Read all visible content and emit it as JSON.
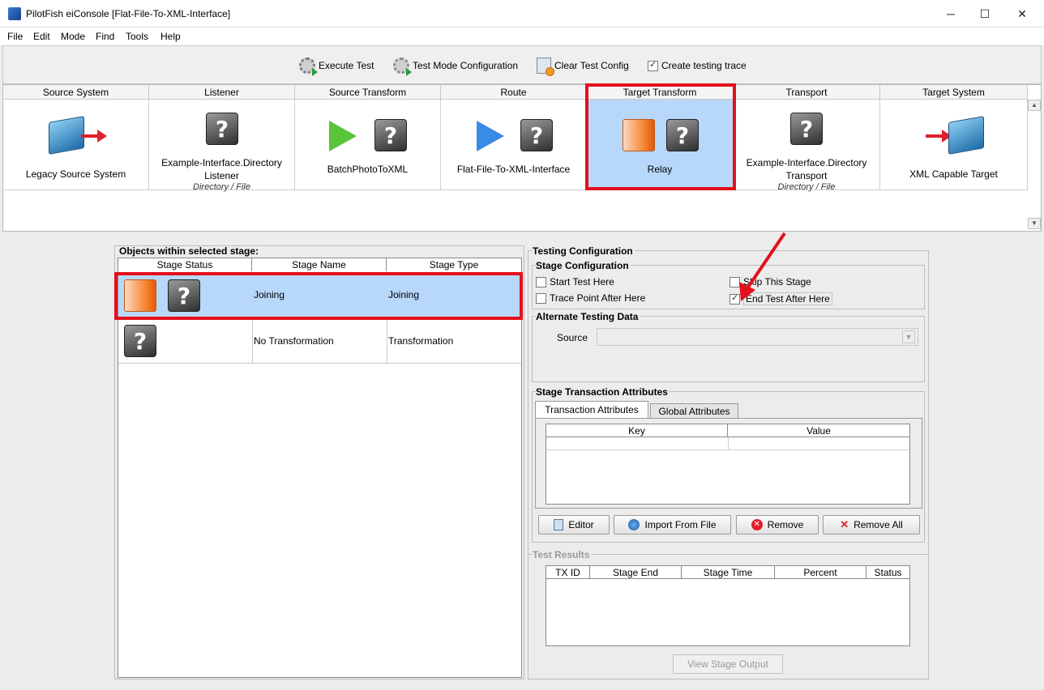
{
  "window": {
    "title": "PilotFish eiConsole [Flat-File-To-XML-Interface]",
    "controls": {
      "minimize": "─",
      "maximize": "☐",
      "close": "✕"
    }
  },
  "menu": [
    "File",
    "Edit",
    "Mode",
    "Find",
    "Tools",
    "Help"
  ],
  "toolbar": {
    "execute_test": "Execute Test",
    "test_mode_config": "Test Mode Configuration",
    "clear_test_config": "Clear Test Config",
    "create_trace": "Create testing trace",
    "create_trace_checked": true
  },
  "stages": [
    {
      "header": "Source System",
      "label": "Legacy Source System",
      "sub": ""
    },
    {
      "header": "Listener",
      "label": "Example-Interface.Directory Listener",
      "sub": "Directory / File"
    },
    {
      "header": "Source Transform",
      "label": "BatchPhotoToXML",
      "sub": ""
    },
    {
      "header": "Route",
      "label": "Flat-File-To-XML-Interface",
      "sub": ""
    },
    {
      "header": "Target Transform",
      "label": "Relay",
      "sub": ""
    },
    {
      "header": "Transport",
      "label": "Example-Interface.Directory Transport",
      "sub": "Directory / File"
    },
    {
      "header": "Target System",
      "label": "XML Capable Target",
      "sub": ""
    }
  ],
  "objects_panel": {
    "title": "Objects within selected stage:",
    "columns": [
      "Stage Status",
      "Stage Name",
      "Stage Type"
    ],
    "rows": [
      {
        "name": "Joining",
        "type": "Joining"
      },
      {
        "name": "No Transformation",
        "type": "Transformation"
      }
    ]
  },
  "testing_config": {
    "title": "Testing Configuration",
    "stage_config_title": "Stage Configuration",
    "start_test_here": "Start Test Here",
    "trace_point_after": "Trace Point After Here",
    "skip_stage": "Skip This Stage",
    "end_test_after": "End Test After Here",
    "alternate_title": "Alternate Testing Data",
    "source_label": "Source",
    "source_value": "",
    "attributes_title": "Stage Transaction Attributes",
    "tabs": [
      "Transaction Attributes",
      "Global Attributes"
    ],
    "attr_columns": [
      "Key",
      "Value"
    ],
    "buttons": {
      "editor": "Editor",
      "import": "Import From File",
      "remove": "Remove",
      "remove_all": "Remove All"
    }
  },
  "test_results": {
    "title": "Test Results",
    "columns": [
      "TX ID",
      "Stage End",
      "Stage Time",
      "Percent",
      "Status"
    ],
    "view_output": "View Stage Output"
  }
}
